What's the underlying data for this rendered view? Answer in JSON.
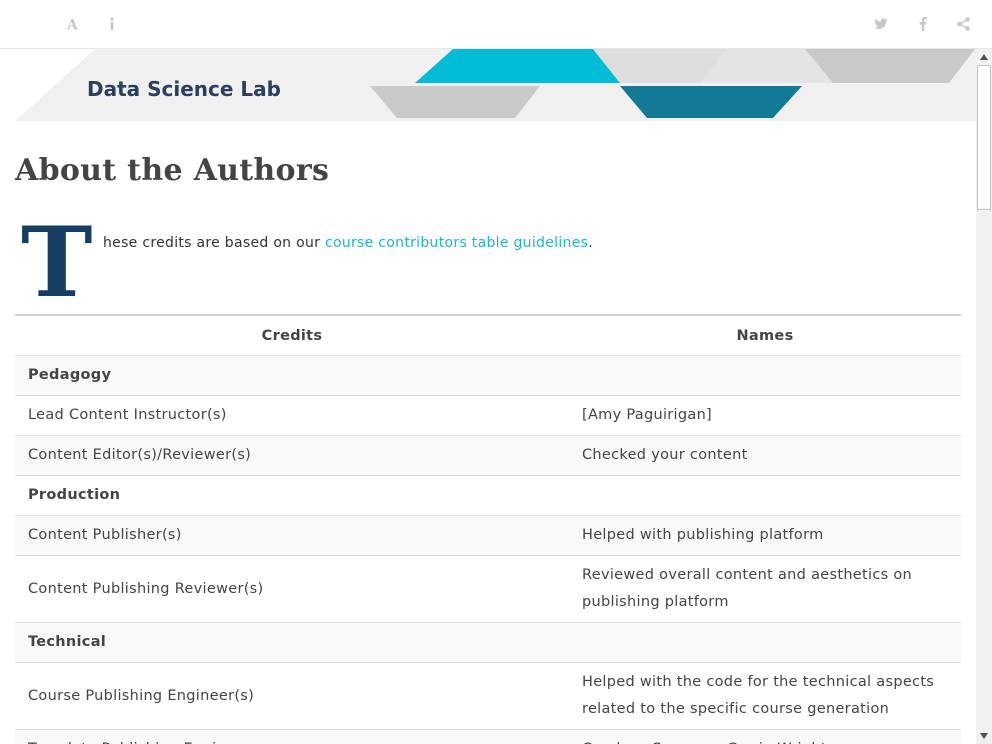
{
  "topbar": {
    "font_icon": "font-size-icon",
    "info_icon": "info-icon",
    "twitter_icon": "twitter-icon",
    "facebook_icon": "facebook-icon",
    "share_icon": "share-icon"
  },
  "banner": {
    "text": "Data Science Lab"
  },
  "page": {
    "title": "About the Authors",
    "dropcap": "T",
    "intro_before": "hese credits are based on our ",
    "intro_link": "course contributors table guidelines",
    "intro_after": "."
  },
  "table": {
    "headers": [
      "Credits",
      "Names"
    ],
    "rows": [
      {
        "credit": "Pedagogy",
        "name": ""
      },
      {
        "credit": "Lead Content Instructor(s)",
        "name": "[Amy Paguirigan]"
      },
      {
        "credit": "Content Editor(s)/Reviewer(s)",
        "name": "Checked your content"
      },
      {
        "credit": "Production",
        "name": ""
      },
      {
        "credit": "Content Publisher(s)",
        "name": "Helped with publishing platform"
      },
      {
        "credit": "Content Publishing Reviewer(s)",
        "name": "Reviewed overall content and aesthetics on publishing platform"
      },
      {
        "credit": "Technical",
        "name": ""
      },
      {
        "credit": "Course Publishing Engineer(s)",
        "name": "Helped with the code for the technical aspects related to the specific course generation"
      },
      {
        "credit": "Template Publishing Engineers",
        "name": "Candace Savonen, Carrie Wright"
      }
    ]
  },
  "colors": {
    "accent_link": "#1bb6c9",
    "dropcap": "#163d63",
    "banner_cyan": "#00bcd4",
    "banner_blue": "#127a94",
    "banner_gray": "#c9c9c9"
  }
}
